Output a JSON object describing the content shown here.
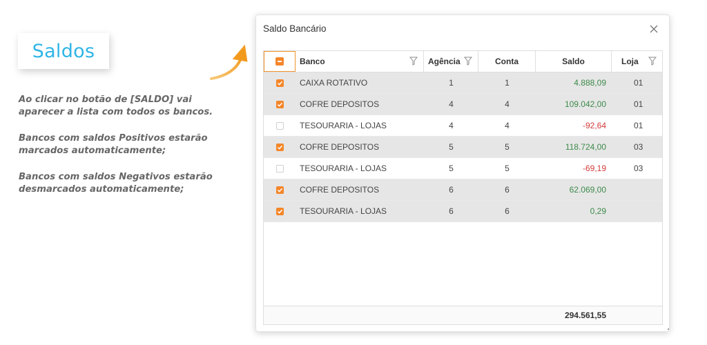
{
  "callout": {
    "label": "Saldos",
    "notes": [
      "Ao clicar no botão de [SALDO] vai aparecer a lista com todos os bancos.",
      "Bancos com saldos Positivos estarão marcados automaticamente;",
      "Bancos com saldos Negativos estarão desmarcados automaticamente;"
    ]
  },
  "dialog": {
    "title": "Saldo Bancário",
    "columns": {
      "banco": "Banco",
      "agencia": "Agência",
      "conta": "Conta",
      "saldo": "Saldo",
      "loja": "Loja"
    },
    "rows": [
      {
        "checked": true,
        "banco": "CAIXA ROTATIVO",
        "agencia": "1",
        "conta": "1",
        "saldo": "4.888,09",
        "loja": "01",
        "sign": "pos"
      },
      {
        "checked": true,
        "banco": "COFRE DEPOSITOS",
        "agencia": "4",
        "conta": "4",
        "saldo": "109.042,00",
        "loja": "01",
        "sign": "pos"
      },
      {
        "checked": false,
        "banco": "TESOURARIA - LOJAS",
        "agencia": "4",
        "conta": "4",
        "saldo": "-92,64",
        "loja": "01",
        "sign": "neg"
      },
      {
        "checked": true,
        "banco": "COFRE DEPOSITOS",
        "agencia": "5",
        "conta": "5",
        "saldo": "118.724,00",
        "loja": "03",
        "sign": "pos"
      },
      {
        "checked": false,
        "banco": "TESOURARIA - LOJAS",
        "agencia": "5",
        "conta": "5",
        "saldo": "-69,19",
        "loja": "03",
        "sign": "neg"
      },
      {
        "checked": true,
        "banco": "COFRE DEPOSITOS",
        "agencia": "6",
        "conta": "6",
        "saldo": "62.069,00",
        "loja": "",
        "sign": "pos"
      },
      {
        "checked": true,
        "banco": "TESOURARIA - LOJAS",
        "agencia": "6",
        "conta": "6",
        "saldo": "0,29",
        "loja": "",
        "sign": "pos"
      }
    ],
    "total": "294.561,55"
  },
  "colors": {
    "accent": "#f4862a",
    "callout_text": "#2fb5e6",
    "positive": "#3c8a4a",
    "negative": "#d23a3a"
  }
}
